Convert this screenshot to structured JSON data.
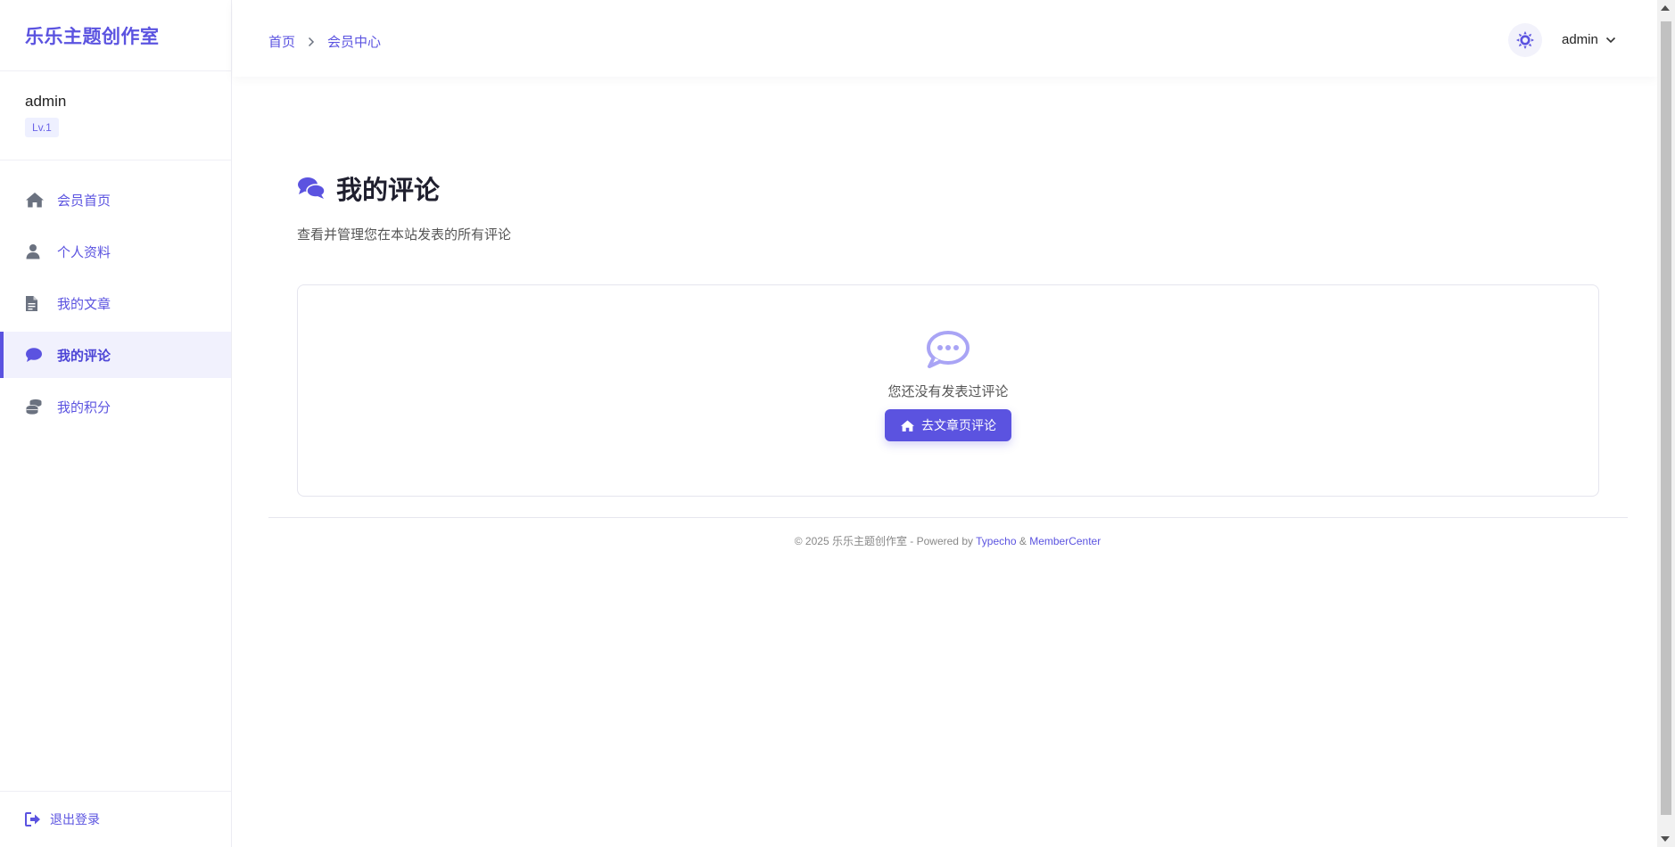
{
  "brand": {
    "title": "乐乐主题创作室"
  },
  "profile": {
    "name": "admin",
    "level": "Lv.1"
  },
  "sidebar": {
    "items": [
      {
        "label": "会员首页",
        "icon": "home-icon",
        "active": false
      },
      {
        "label": "个人资料",
        "icon": "user-icon",
        "active": false
      },
      {
        "label": "我的文章",
        "icon": "file-icon",
        "active": false
      },
      {
        "label": "我的评论",
        "icon": "comment-icon",
        "active": true
      },
      {
        "label": "我的积分",
        "icon": "coins-icon",
        "active": false
      }
    ],
    "logout_label": "退出登录"
  },
  "topbar": {
    "breadcrumb": [
      "首页",
      "会员中心"
    ],
    "user": "admin"
  },
  "main": {
    "title": "我的评论",
    "subtitle": "查看并管理您在本站发表的所有评论",
    "empty_text": "您还没有发表过评论",
    "button_label": "去文章页评论"
  },
  "footer": {
    "prefix": "© 2025 乐乐主题创作室 - Powered by",
    "link1": "Typecho",
    "amp": "&",
    "link2": "MemberCenter"
  },
  "colors": {
    "accent": "#5b53e0",
    "accent_light": "#eef0ff",
    "active_bg": "#f1f1fd"
  }
}
